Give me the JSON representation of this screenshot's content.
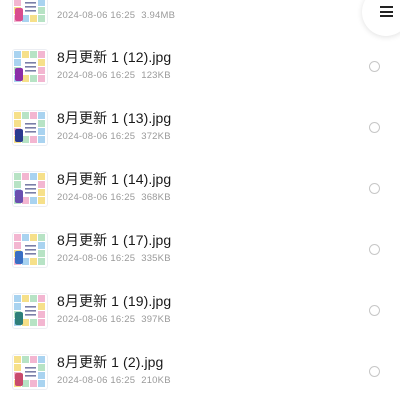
{
  "files": [
    {
      "name": "",
      "date": "2024-08-06 16:25",
      "size": "3.94MB",
      "thumb_accent": "#d94c8e"
    },
    {
      "name": "8月更新 1 (12).jpg",
      "date": "2024-08-06 16:25",
      "size": "123KB",
      "thumb_accent": "#8b2ea8"
    },
    {
      "name": "8月更新 1 (13).jpg",
      "date": "2024-08-06 16:25",
      "size": "372KB",
      "thumb_accent": "#2b3a8f"
    },
    {
      "name": "8月更新 1 (14).jpg",
      "date": "2024-08-06 16:25",
      "size": "368KB",
      "thumb_accent": "#6a4fb0"
    },
    {
      "name": "8月更新 1 (17).jpg",
      "date": "2024-08-06 16:25",
      "size": "335KB",
      "thumb_accent": "#3a6fc4"
    },
    {
      "name": "8月更新 1 (19).jpg",
      "date": "2024-08-06 16:25",
      "size": "397KB",
      "thumb_accent": "#2f7f7a"
    },
    {
      "name": "8月更新 1 (2).jpg",
      "date": "2024-08-06 16:25",
      "size": "210KB",
      "thumb_accent": "#c94b6d"
    }
  ],
  "menu_button": {
    "icon": "menu-icon"
  },
  "colors": {
    "tile_pink": "#f3b6d1",
    "tile_blue": "#a9d3f0",
    "tile_yellow": "#f6e08a",
    "tile_green": "#b7e3c5"
  }
}
